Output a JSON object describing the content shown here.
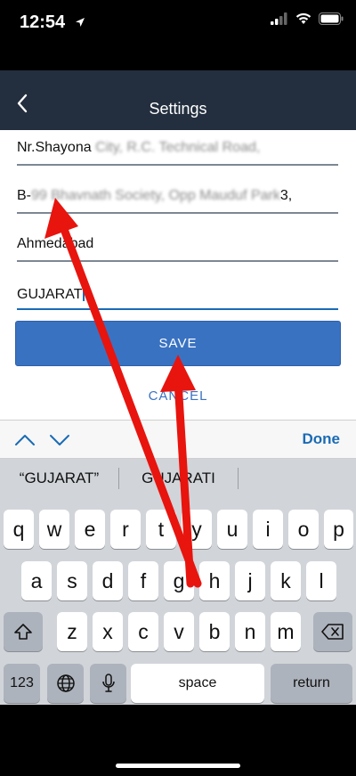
{
  "status_bar": {
    "time": "12:54"
  },
  "nav": {
    "title": "Settings"
  },
  "form": {
    "fields": [
      {
        "visible": "Nr.Shayona ",
        "obscured": "City, R.C. Technical Road,"
      },
      {
        "visible": "B-",
        "obscured": "99 Bhavnath Society, Opp Mauduf Park",
        "tail": "3,"
      },
      {
        "visible": "Ahmedabad",
        "obscured": ""
      },
      {
        "visible": "GUJARAT",
        "obscured": ""
      }
    ],
    "save_label": "SAVE",
    "cancel_label": "CANCEL"
  },
  "toolbar": {
    "done_label": "Done"
  },
  "keyboard": {
    "suggestions": [
      "“GUJARAT”",
      "GUJARATI",
      ""
    ],
    "row1": [
      "q",
      "w",
      "e",
      "r",
      "t",
      "y",
      "u",
      "i",
      "o",
      "p"
    ],
    "row2": [
      "a",
      "s",
      "d",
      "f",
      "g",
      "h",
      "j",
      "k",
      "l"
    ],
    "row3": [
      "z",
      "x",
      "c",
      "v",
      "b",
      "n",
      "m"
    ],
    "numbers_label": "123",
    "space_label": "space",
    "return_label": "return"
  },
  "colors": {
    "nav_bg": "#232f3e",
    "accent_blue": "#3a72c2",
    "arrow_red": "#e8140e"
  }
}
